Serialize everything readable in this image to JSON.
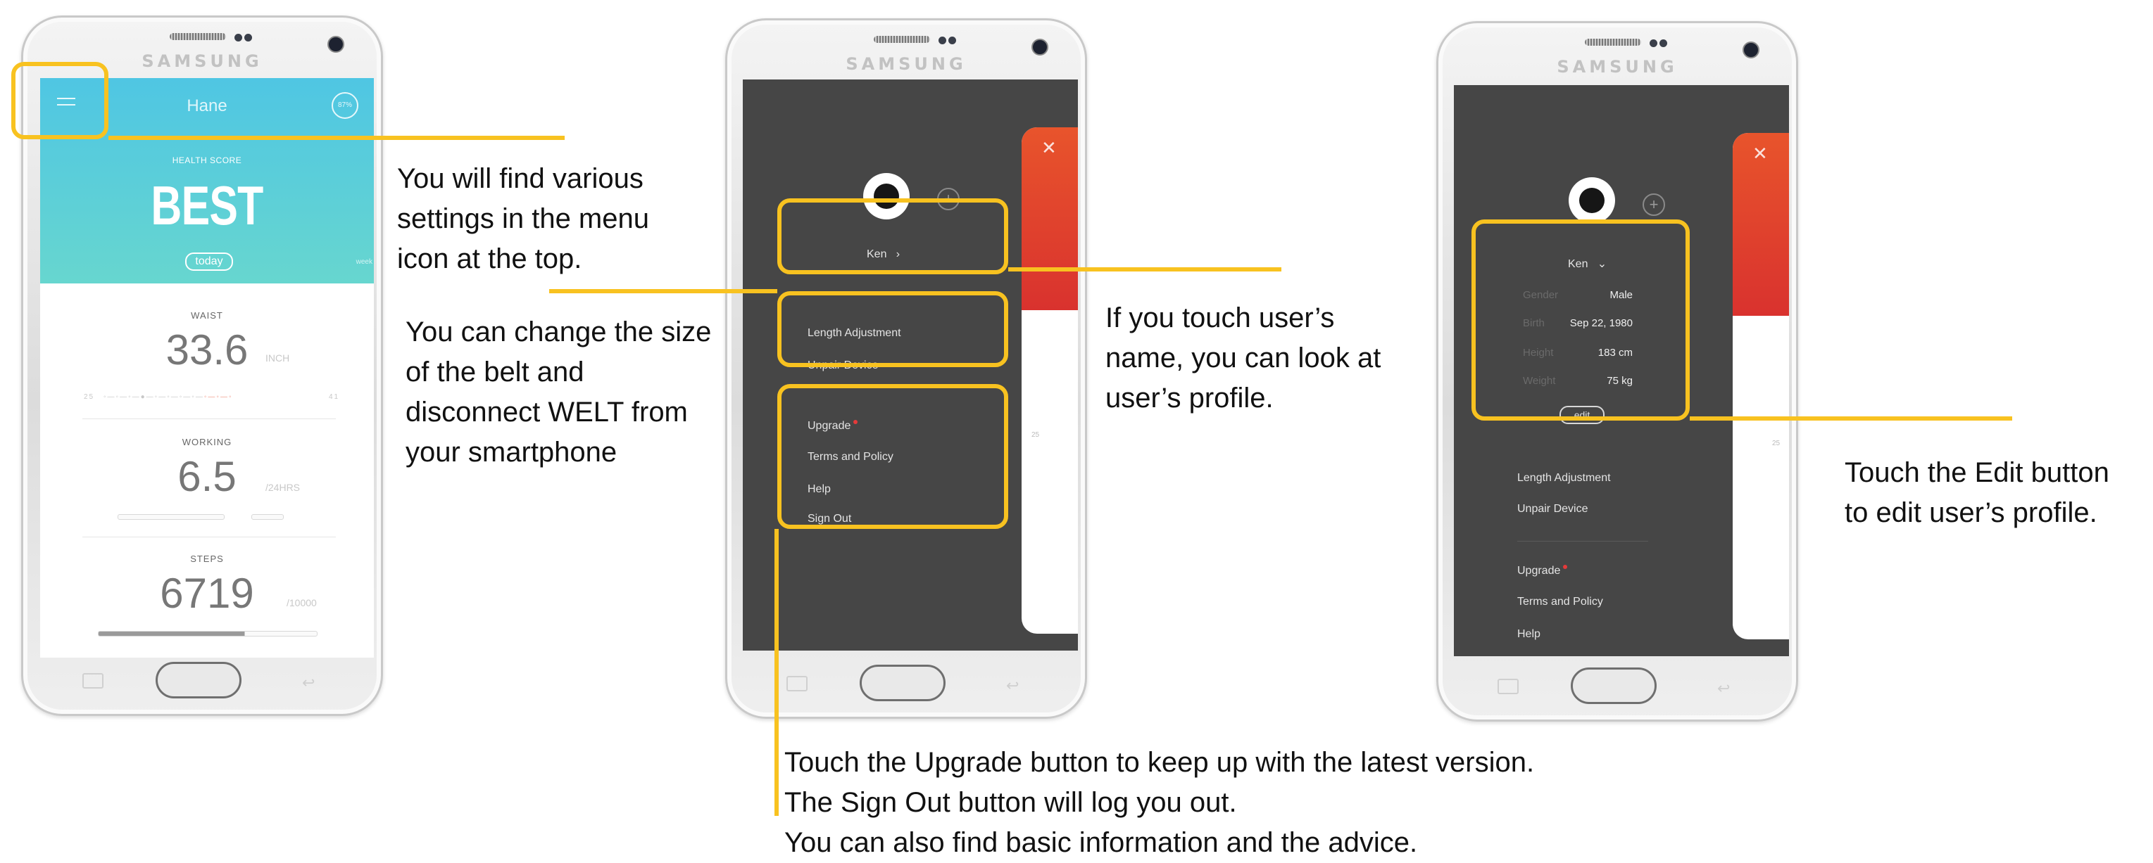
{
  "phone_brand": "SAMSUNG",
  "phone1": {
    "title": "Hane",
    "battery": "87%",
    "health_score_label": "HEALTH SCORE",
    "health_score_value": "BEST",
    "today_label": "today",
    "week_label": "week",
    "waist": {
      "label": "WAIST",
      "value": "33.6",
      "unit": "INCH",
      "range_min": "25",
      "range_max": "41"
    },
    "working": {
      "label": "WORKING",
      "value": "6.5",
      "unit": "/24HRS"
    },
    "steps": {
      "label": "STEPS",
      "value": "6719",
      "unit": "/10000"
    }
  },
  "menu": {
    "user_name": "Ken",
    "items_device": [
      "Length Adjustment",
      "Unpair Device"
    ],
    "items_more": [
      "Upgrade",
      "Terms and Policy",
      "Help",
      "Sign Out"
    ],
    "card_tick": "25"
  },
  "profile": {
    "user_name": "Ken",
    "fields": [
      {
        "label": "Gender",
        "value": "Male"
      },
      {
        "label": "Birth",
        "value": "Sep 22, 1980"
      },
      {
        "label": "Height",
        "value": "183 cm"
      },
      {
        "label": "Weight",
        "value": "75 kg"
      }
    ],
    "edit_label": "edit"
  },
  "callouts": {
    "menu_icon": "You will find various\nsettings in the menu\nicon at the top.",
    "belt": "You can change the size\nof the belt and\ndisconnect WELT from\nyour smartphone",
    "user_name": "If you touch user’s\nname, you can look at\nuser’s profile.",
    "edit": "Touch the Edit button\nto edit user’s profile.",
    "upgrade": "Touch the Upgrade button to keep up with the latest version.\nThe Sign Out button will log you out.\nYou can also find basic information and  the advice."
  },
  "colors": {
    "highlight": "#f8c220",
    "header_teal": "#55c8e0",
    "menu_bg": "#464646",
    "card_red": "#e14a2d"
  }
}
